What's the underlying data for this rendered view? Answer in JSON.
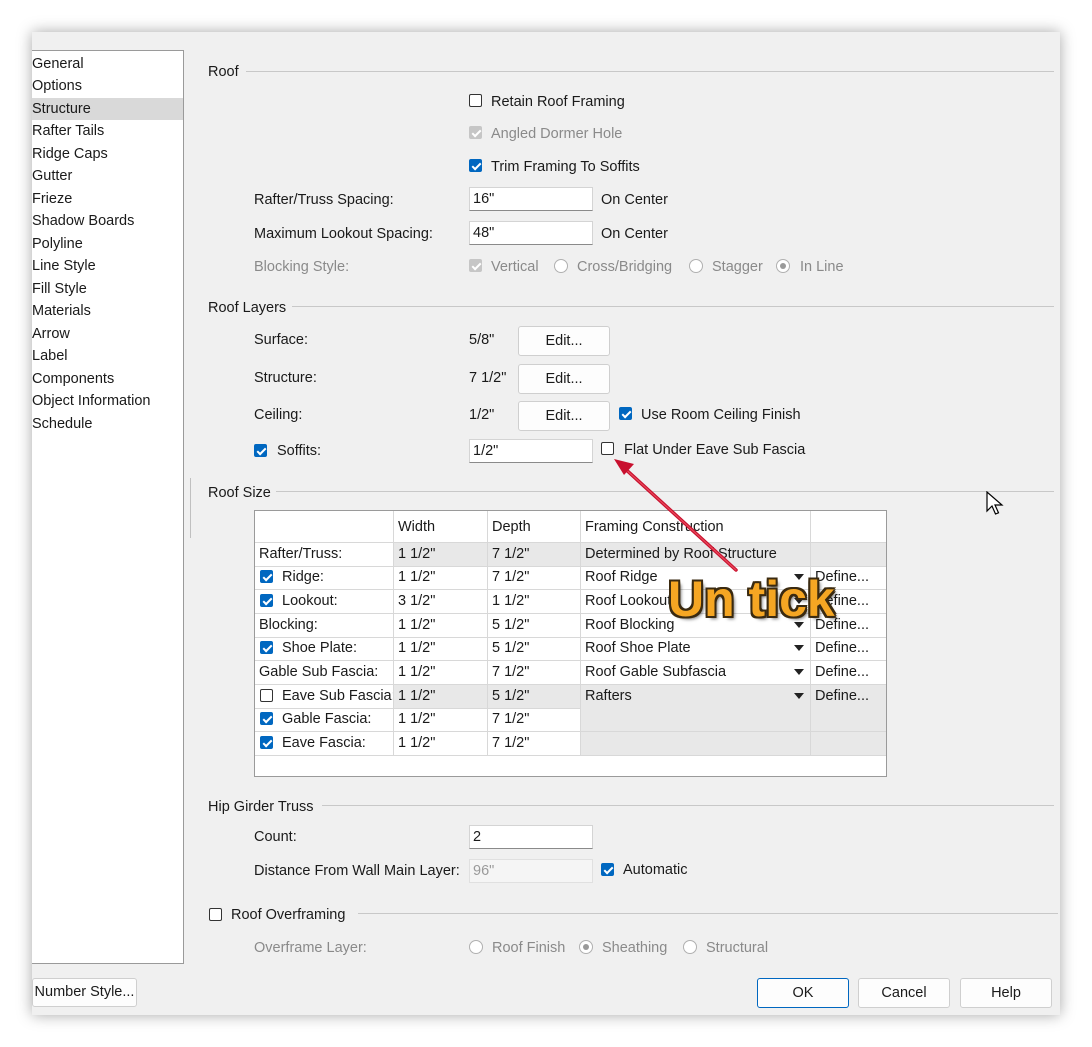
{
  "sidebar": {
    "items": [
      "General",
      "Options",
      "Structure",
      "Rafter Tails",
      "Ridge Caps",
      "Gutter",
      "Frieze",
      "Shadow Boards",
      "Polyline",
      "Line Style",
      "Fill Style",
      "Materials",
      "Arrow",
      "Label",
      "Components",
      "Object Information",
      "Schedule"
    ],
    "selected": "Structure"
  },
  "roof": {
    "title": "Roof",
    "retain_roof_framing": {
      "label": "Retain Roof Framing",
      "checked": false
    },
    "angled_dormer_hole": {
      "label": "Angled Dormer Hole",
      "checked": true,
      "disabled": true
    },
    "trim_framing": {
      "label": "Trim Framing To Soffits",
      "checked": true
    },
    "rafter_spacing": {
      "label": "Rafter/Truss Spacing:",
      "value": "16\"",
      "suffix": "On Center"
    },
    "lookout_spacing": {
      "label": "Maximum Lookout Spacing:",
      "value": "48\"",
      "suffix": "On Center"
    },
    "blocking_style": {
      "label": "Blocking Style:",
      "vertical": "Vertical",
      "cross": "Cross/Bridging",
      "stagger": "Stagger",
      "inline": "In Line",
      "selected": "In Line"
    }
  },
  "roof_layers": {
    "title": "Roof Layers",
    "surface": {
      "label": "Surface:",
      "value": "5/8\"",
      "button": "Edit..."
    },
    "structure": {
      "label": "Structure:",
      "value": "7 1/2\"",
      "button": "Edit..."
    },
    "ceiling": {
      "label": "Ceiling:",
      "value": "1/2\"",
      "button": "Edit...",
      "room_ceiling_label": "Use Room Ceiling Finish",
      "room_ceiling_checked": true
    },
    "soffits": {
      "label": "Soffits:",
      "checked": true,
      "value": "1/2\"",
      "flat_label": "Flat Under Eave Sub Fascia",
      "flat_checked": false
    }
  },
  "roof_size": {
    "title": "Roof Size",
    "columns": [
      "Width",
      "Depth",
      "Framing Construction"
    ],
    "rows": [
      {
        "label": "Rafter/Truss:",
        "checkbox": null,
        "width": "1 1/2\"",
        "depth": "7 1/2\"",
        "framing": "Determined by Roof Structure",
        "define": ""
      },
      {
        "label": "Ridge:",
        "checkbox": true,
        "width": "1 1/2\"",
        "depth": "7 1/2\"",
        "framing": "Roof Ridge",
        "define": "Define..."
      },
      {
        "label": "Lookout:",
        "checkbox": true,
        "width": "3 1/2\"",
        "depth": "1 1/2\"",
        "framing": "Roof Lookout",
        "define": "Define..."
      },
      {
        "label": "Blocking:",
        "checkbox": null,
        "width": "1 1/2\"",
        "depth": "5 1/2\"",
        "framing": "Roof Blocking",
        "define": "Define..."
      },
      {
        "label": "Shoe Plate:",
        "checkbox": true,
        "width": "1 1/2\"",
        "depth": "5 1/2\"",
        "framing": "Roof Shoe Plate",
        "define": "Define..."
      },
      {
        "label": "Gable Sub Fascia:",
        "checkbox": null,
        "width": "1 1/2\"",
        "depth": "7 1/2\"",
        "framing": "Roof Gable Subfascia",
        "define": "Define..."
      },
      {
        "label": "Eave Sub Fascia:",
        "checkbox": false,
        "width": "1 1/2\"",
        "depth": "5 1/2\"",
        "framing": "Rafters",
        "define": "Define..."
      },
      {
        "label": "Gable Fascia:",
        "checkbox": true,
        "width": "1 1/2\"",
        "depth": "7 1/2\"",
        "framing": "",
        "define": ""
      },
      {
        "label": "Eave Fascia:",
        "checkbox": true,
        "width": "1 1/2\"",
        "depth": "7 1/2\"",
        "framing": "",
        "define": ""
      }
    ]
  },
  "hip_girder": {
    "title": "Hip Girder Truss",
    "count": {
      "label": "Count:",
      "value": "2"
    },
    "distance": {
      "label": "Distance From Wall Main Layer:",
      "value": "96\"",
      "automatic_label": "Automatic",
      "automatic_checked": true
    }
  },
  "overframing": {
    "title": "Roof Overframing",
    "checked": false,
    "layer_label": "Overframe Layer:",
    "roof_finish": "Roof Finish",
    "sheathing": "Sheathing",
    "structural": "Structural",
    "selected": "Sheathing"
  },
  "footer": {
    "number_style": "Number Style...",
    "ok": "OK",
    "cancel": "Cancel",
    "help": "Help"
  },
  "annotation": {
    "text": "Un tick",
    "color": "#f5a623",
    "arrow_color": "#c8102e"
  },
  "colors": {
    "accent": "#0067c0",
    "dialog_bg": "#f0f0f0",
    "selected_item": "#d9d9d9"
  }
}
